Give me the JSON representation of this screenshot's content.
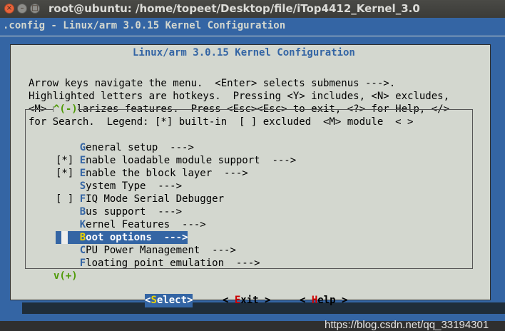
{
  "window": {
    "title": "root@ubuntu: /home/topeet/Desktop/file/iTop4412_Kernel_3.0",
    "close_glyph": "×",
    "minimize_glyph": "–",
    "maximize_glyph": "□"
  },
  "terminal": {
    "header": ".config - Linux/arm 3.0.15 Kernel Configuration"
  },
  "dialog": {
    "title": "Linux/arm 3.0.15 Kernel Configuration",
    "help_lines": [
      "Arrow keys navigate the menu.  <Enter> selects submenus --->.",
      "Highlighted letters are hotkeys.  Pressing <Y> includes, <N> excludes,",
      "<M> modularizes features.  Press <Esc><Esc> to exit, <?> for Help, </>",
      "for Search.  Legend: [*] built-in  [ ] excluded  <M> module  < >"
    ],
    "scroll_up": "^(-)",
    "scroll_down": "v(+)"
  },
  "menu": {
    "items": [
      {
        "prefix": "    ",
        "hotkey": "G",
        "rest": "eneral setup  --->"
      },
      {
        "prefix": "[*] ",
        "hotkey": "E",
        "rest": "nable loadable module support  --->"
      },
      {
        "prefix": "[*] ",
        "hotkey": "E",
        "rest": "nable the block layer  --->"
      },
      {
        "prefix": "    ",
        "hotkey": "S",
        "rest": "ystem Type  --->"
      },
      {
        "prefix": "[ ] ",
        "hotkey": "F",
        "rest": "IQ Mode Serial Debugger"
      },
      {
        "prefix": "    ",
        "hotkey": "B",
        "rest": "us support  --->"
      },
      {
        "prefix": "    ",
        "hotkey": "K",
        "rest": "ernel Features  --->"
      },
      {
        "prefix": "    ",
        "hotkey": "B",
        "rest": "oot options  --->"
      },
      {
        "prefix": "    ",
        "hotkey": "C",
        "rest": "PU Power Management  --->"
      },
      {
        "prefix": "    ",
        "hotkey": "F",
        "rest": "loating point emulation  --->"
      }
    ],
    "selected_index": 7
  },
  "buttons": {
    "select": {
      "open": "<",
      "hotkey": "S",
      "rest": "elect",
      "close": ">"
    },
    "exit": {
      "open": "< ",
      "hotkey": "E",
      "rest": "xit",
      "close": " >"
    },
    "help": {
      "open": "< ",
      "hotkey": "H",
      "rest": "elp",
      "close": " >"
    }
  },
  "watermark": "https://blog.csdn.net/qq_33194301",
  "colors": {
    "terminal_bg": "#3465a4",
    "dialog_bg": "#d3d7cf",
    "selection_bg": "#3465a4",
    "hotkey_selected": "#edd400",
    "button_hotkey": "#cc0000",
    "scroll_indicator": "#4e9a06"
  }
}
